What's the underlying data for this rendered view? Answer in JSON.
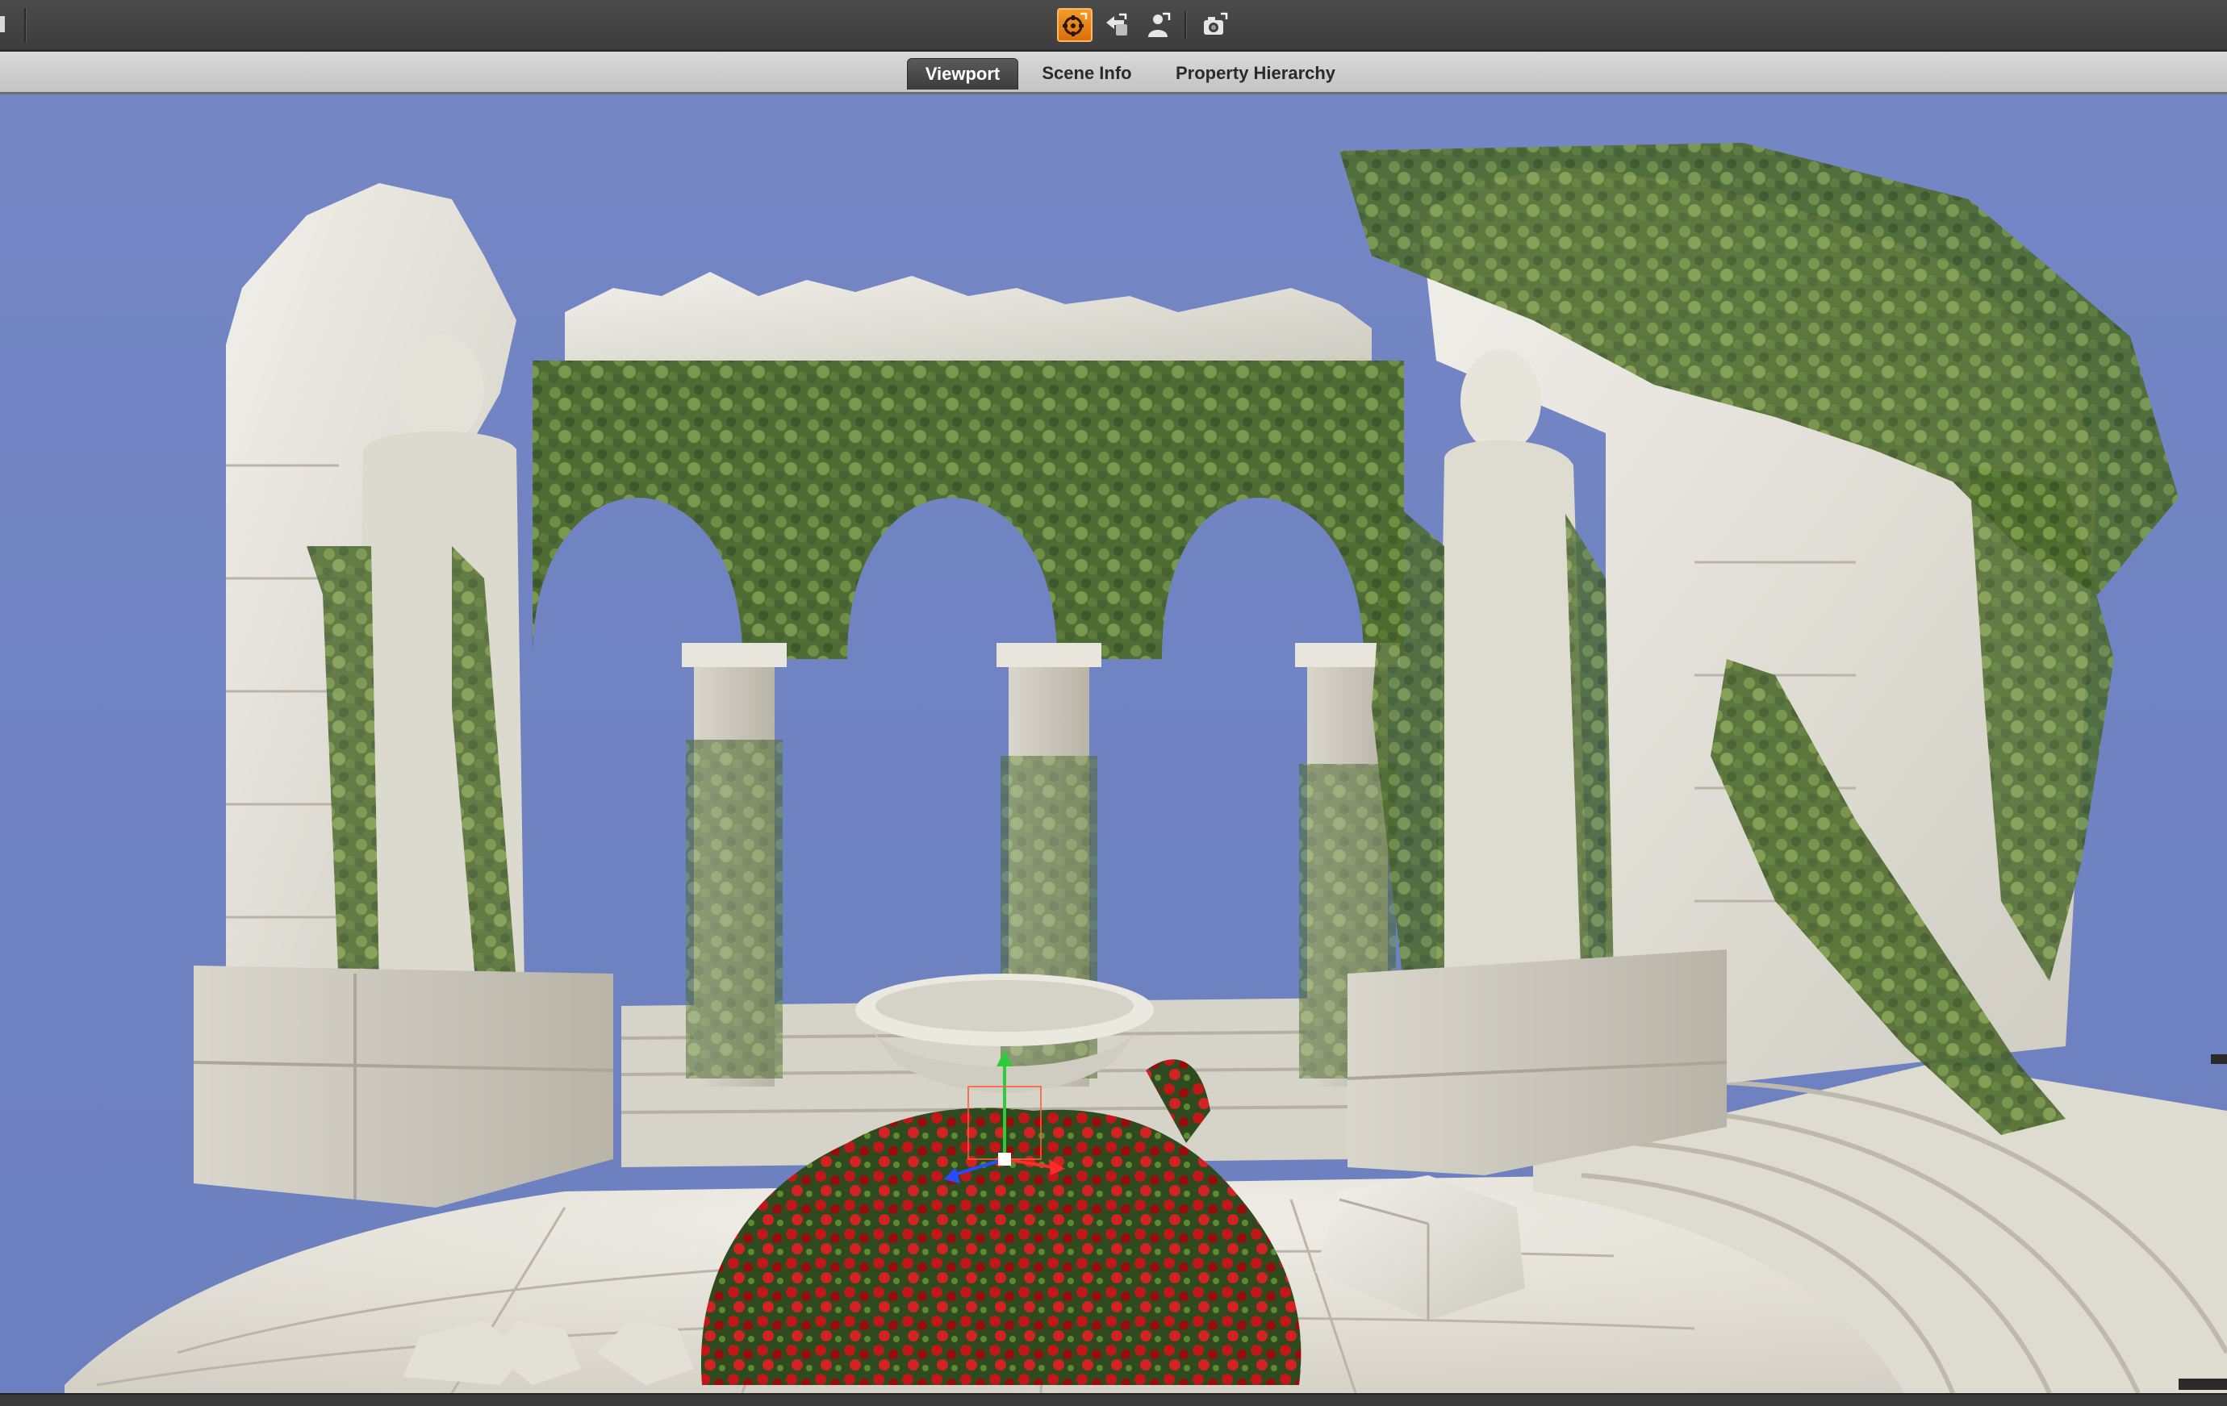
{
  "toolbar": {
    "buttons": [
      {
        "icon": "render-settings-icon",
        "active": true
      },
      {
        "icon": "render-icon",
        "active": false
      },
      {
        "icon": "figure-render-icon",
        "active": false
      },
      {
        "icon": "camera-icon",
        "active": false
      }
    ],
    "accent": "#e8861c"
  },
  "tabs": [
    {
      "label": "Viewport",
      "selected": true
    },
    {
      "label": "Scene Info",
      "selected": false
    },
    {
      "label": "Property Hierarchy",
      "selected": false
    }
  ],
  "viewport": {
    "scene": "garden ruins with ivy-covered arches, statues, fountain and red roses",
    "background_color": "#7385c2",
    "manipulator_icon": "transform-gizmo-icon"
  }
}
